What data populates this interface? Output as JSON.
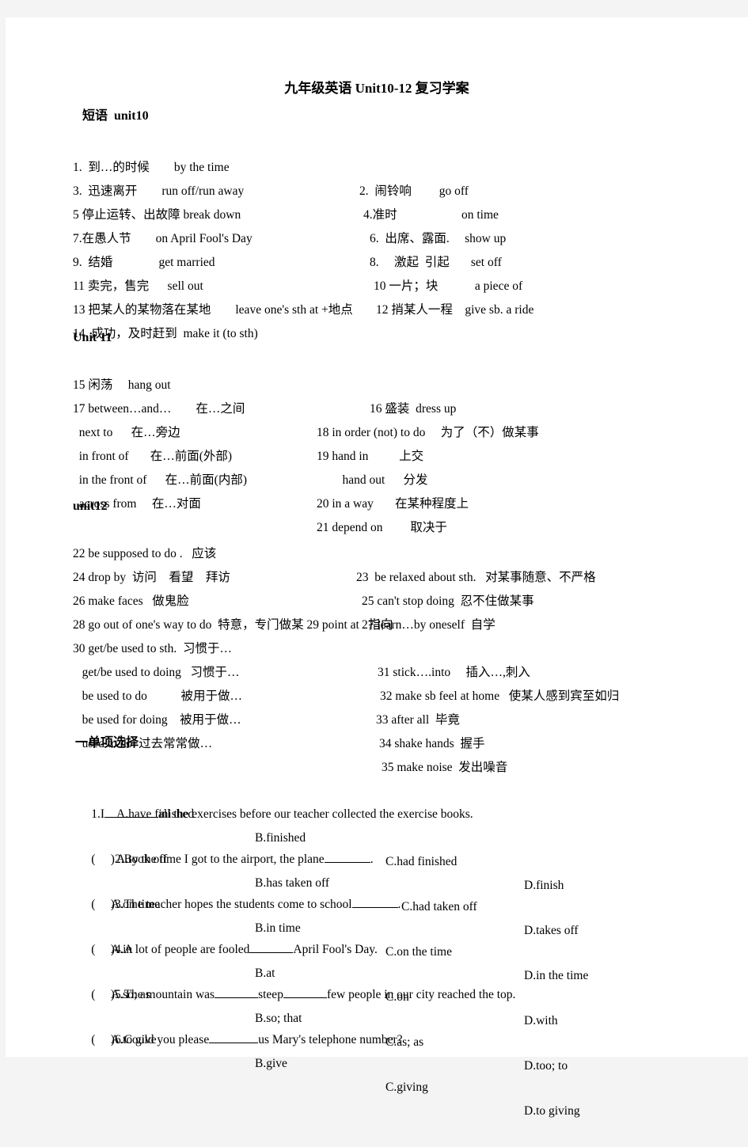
{
  "document": {
    "title": "九年级英语 Unit10-12 复习学案",
    "sections": {
      "phrases_unit10_head": "短语  unit10",
      "unit11_head": "Unit 11",
      "unit12_head": "unit12",
      "choice_head": "一单项选择"
    }
  },
  "unit10": {
    "lines": [
      {
        "left": "1.  到…的时候        by the time",
        "right": "2.  闹铃响         go off"
      },
      {
        "left": "3.  迅速离开        run off/run away",
        "right": "4.准时                     on time"
      },
      {
        "left": "5 停止运转、出故障 break down",
        "right": "6.  出席、露面.     show up"
      },
      {
        "left": "7.在愚人节        on April Fool's Day",
        "right": "8.     激起  引起       set off"
      },
      {
        "left": "9.  结婚               get married",
        "right": "10 一片；块            a piece of"
      },
      {
        "left": "11 卖完，售完      sell out",
        "right": "12 捎某人一程    give sb. a ride"
      },
      {
        "left": "13 把某人的某物落在某地        leave one's sth at +地点",
        "right": ""
      },
      {
        "left": "14  成功，及时赶到  make it (to sth)",
        "right": ""
      }
    ]
  },
  "unit11": {
    "lines": [
      {
        "left": "15 闲荡     hang out",
        "right": "16 盛装  dress up"
      },
      {
        "left": "17 between…and…        在…之间",
        "right": "18 in order (not) to do     为了（不）做某事"
      },
      {
        "left": "  next to      在…旁边",
        "right": "19 hand in          上交"
      },
      {
        "left": "  in front of       在…前面(外部)",
        "right": "    hand out      分发"
      },
      {
        "left": "  in the front of      在…前面(内部)",
        "right": "20 in a way       在某种程度上"
      },
      {
        "left": "  across from     在…对面",
        "right": "21 depend on         取决于"
      }
    ]
  },
  "unit12": {
    "lines": [
      {
        "left": "22 be supposed to do .   应该",
        "right": "23  be relaxed about sth.   对某事随意、不严格"
      },
      {
        "left": "24 drop by  访问    看望    拜访",
        "right": "25 can't stop doing  忍不住做某事"
      },
      {
        "left": "26 make faces   做鬼脸",
        "right": "27 learn…by oneself  自学"
      },
      {
        "left": "28 go out of one's way to do  特意，专门做某 29 point at   指向",
        "right": ""
      },
      {
        "left": "30 get/be used to sth.  习惯于…",
        "right": "31 stick….into     插入…,刺入"
      },
      {
        "left": "   get/be used to doing   习惯于…",
        "right": "32 make sb feel at home   使某人感到宾至如归"
      },
      {
        "left": "   be used to do           被用于做…",
        "right": "33 after all  毕竟"
      },
      {
        "left": "   be used for doing    被用于做…",
        "right": "34 shake hands  握手"
      },
      {
        "left": "   used to do  过去常常做…",
        "right": "35 make noise  发出噪音"
      }
    ]
  },
  "choices": [
    {
      "marker": "",
      "number": "1.",
      "stem_before": "I",
      "stem_after": "all the exercises before our teacher collected the exercise books.",
      "options": [
        "A.have finished",
        "B.finished",
        "C.had finished",
        "D.finish"
      ]
    },
    {
      "marker": "(     )",
      "number": "2.",
      "stem_before": "By the time I got to the airport, the plane",
      "stem_after": ".",
      "options": [
        "A.took off",
        "B.has taken off",
        "C.had taken off",
        "D.takes off"
      ]
    },
    {
      "marker": "(     )",
      "number": "3.",
      "stem_before": "The teacher hopes the students come to school",
      "stem_after": ".",
      "options": [
        "A.on time",
        "B.in time",
        "C.on the time",
        "D.in the time"
      ]
    },
    {
      "marker": "(     )",
      "number": "4.",
      "stem_before": "A lot of people are fooled",
      "stem_after": "April Fool's Day.",
      "options": [
        "A.in",
        "B.at",
        "C.on",
        "D.with"
      ]
    },
    {
      "marker": "(     )",
      "number": "5.",
      "stem_before": "The mountain was",
      "stem_mid": "steep",
      "stem_after": "few people in our city reached the top.",
      "options": [
        "A.so; as",
        "B.so; that",
        "C.as; as",
        "D.too; to"
      ]
    },
    {
      "marker": "(     )",
      "number": "6.",
      "stem_before": "Could you please",
      "stem_after": "us Mary's telephone number?",
      "options": [
        "A.to give",
        "B.give",
        "C.giving",
        "D.to giving"
      ]
    }
  ]
}
